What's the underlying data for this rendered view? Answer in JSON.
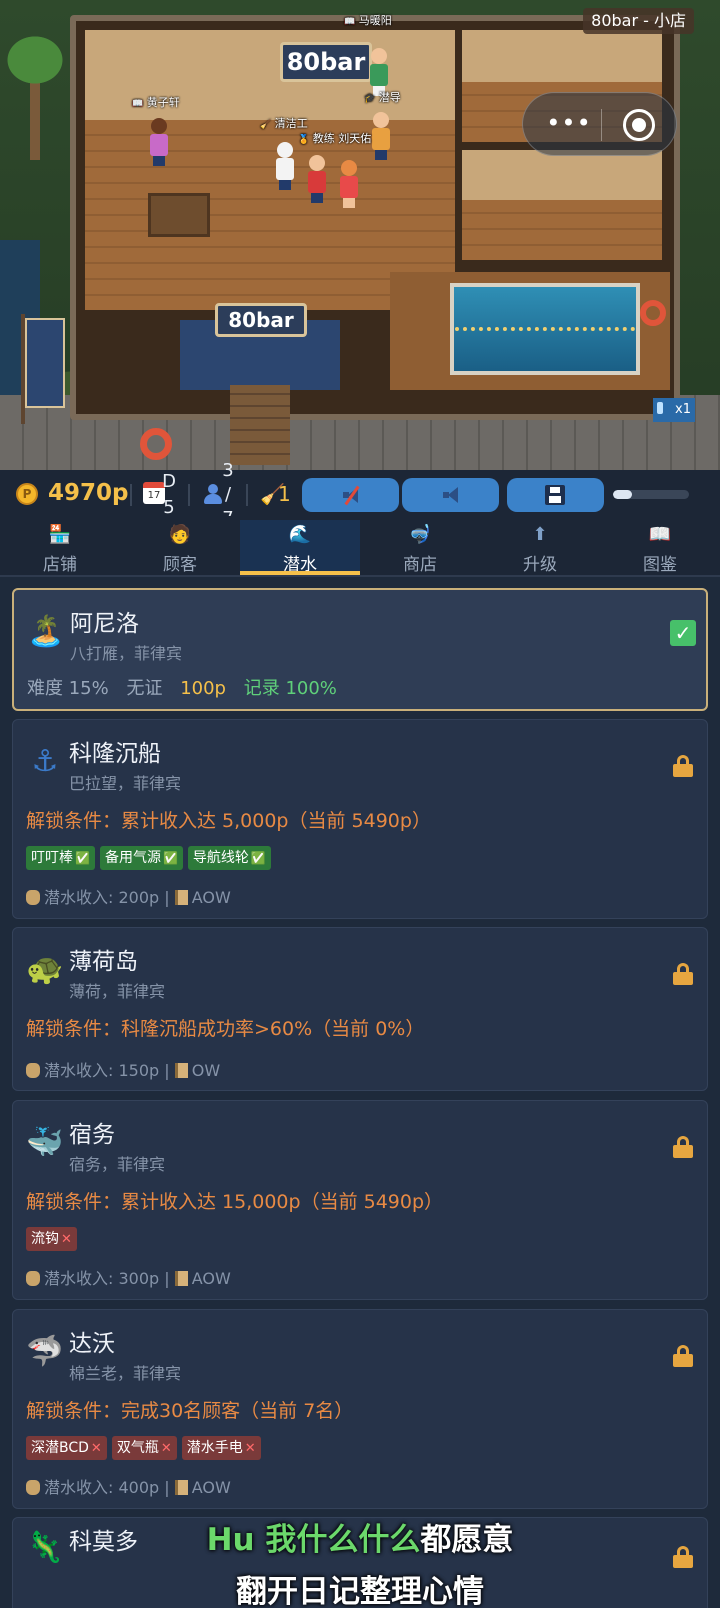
{
  "scene": {
    "sign_top": "80bar",
    "sign_door": "80bar",
    "title_badge": "80bar - 小店",
    "speed": "x1",
    "npcs": [
      {
        "name": "马暖阳"
      },
      {
        "name": "黄子轩"
      },
      {
        "name": "潜导"
      },
      {
        "name": "清洁工"
      },
      {
        "name": "教练 刘天佑"
      }
    ],
    "capsule_more": "•••"
  },
  "status": {
    "coin_glyph": "P",
    "money": "4970p",
    "calendar_day": "17",
    "day_text": "D5",
    "day_letter": "D",
    "day_number": "5",
    "customers_current": "3",
    "customers_slash": "/",
    "customers_max": "7",
    "cleaners": "1",
    "progress": 0.25
  },
  "tabs": [
    {
      "label": "店铺",
      "icon": "shop-icon"
    },
    {
      "label": "顾客",
      "icon": "customer-icon"
    },
    {
      "label": "潜水",
      "icon": "dive-icon"
    },
    {
      "label": "商店",
      "icon": "store-icon"
    },
    {
      "label": "升级",
      "icon": "upgrade-icon"
    },
    {
      "label": "图鉴",
      "icon": "book-icon"
    }
  ],
  "active_tab": 2,
  "sites": [
    {
      "name": "阿尼洛",
      "location": "八打雁，菲律宾",
      "icon": "island-icon",
      "difficulty": "难度 15%",
      "cert": "无证",
      "price": "100p",
      "record": "记录 100%"
    },
    {
      "name": "科隆沉船",
      "location": "巴拉望，菲律宾",
      "icon": "anchor-icon",
      "unlock": "解锁条件：累计收入达 5,000p（当前 5490p）",
      "tags": [
        "叮叮棒",
        "备用气源",
        "导航线轮"
      ],
      "income": "潜水收入: 200p",
      "cert": "AOW"
    },
    {
      "name": "薄荷岛",
      "location": "薄荷，菲律宾",
      "icon": "turtle-icon",
      "unlock": "解锁条件：科隆沉船成功率>60%（当前 0%）",
      "income": "潜水收入: 150p",
      "cert": "OW"
    },
    {
      "name": "宿务",
      "location": "宿务，菲律宾",
      "icon": "whale-icon",
      "unlock": "解锁条件：累计收入达 15,000p（当前 5490p）",
      "tags": [
        "流钩"
      ],
      "income": "潜水收入: 300p",
      "cert": "AOW"
    },
    {
      "name": "达沃",
      "location": "棉兰老，菲律宾",
      "icon": "shark-icon",
      "unlock": "解锁条件：完成30名顾客（当前 7名）",
      "tags": [
        "深潜BCD",
        "双气瓶",
        "潜水手电"
      ],
      "income": "潜水收入: 400p",
      "cert": "AOW"
    },
    {
      "name": "科莫多",
      "icon": "dragon-icon"
    }
  ],
  "subtitles": {
    "line1_highlight": "Hu 我什么什么",
    "line1_rest": "都愿意",
    "line2": "翻开日记整理心情"
  },
  "colors": {
    "accent_gold": "#f5c04a",
    "unlock_orange": "#e88a44",
    "record_green": "#5fd07a",
    "button_blue": "#3b82c9"
  }
}
